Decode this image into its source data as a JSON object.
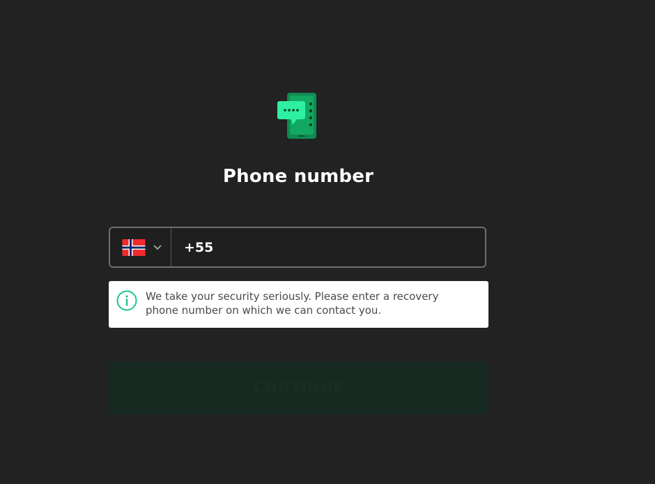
{
  "page": {
    "title": "Phone number"
  },
  "phone_field": {
    "country_flag_icon": "norway-flag-icon",
    "country_dropdown_icon": "chevron-down-icon",
    "value": "+55"
  },
  "info": {
    "icon": "info-circle-icon",
    "message": "We take your security seriously. Please enter a recovery phone number on which we can contact you."
  },
  "continue_button": {
    "label": "CONTINUE",
    "state": "disabled"
  },
  "colors": {
    "background": "#222222",
    "accent_green": "#1fd68a",
    "info_icon": "#20c488",
    "button_disabled_bg": "#162a22"
  }
}
